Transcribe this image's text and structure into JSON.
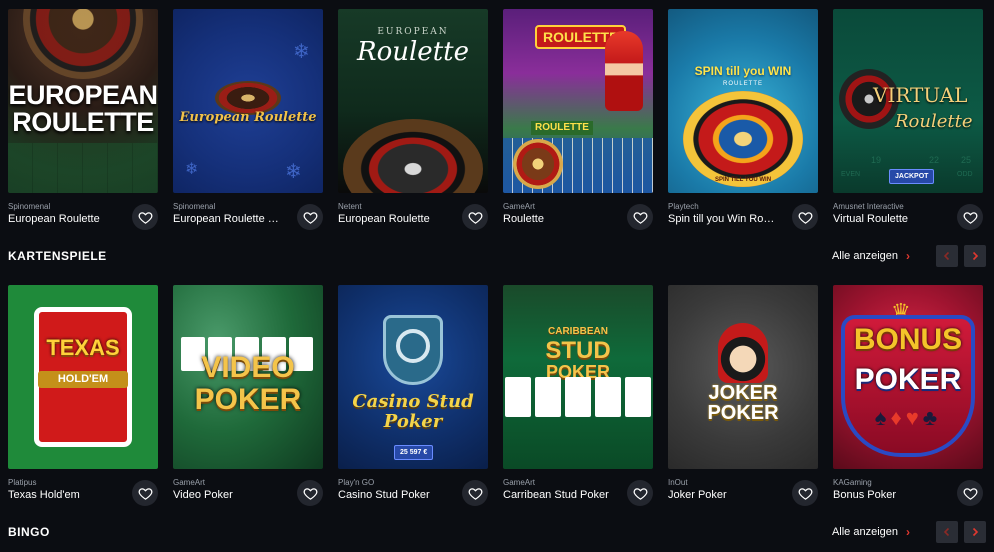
{
  "roulette_games": [
    {
      "provider": "Spinomenal",
      "name": "European Roulette",
      "art": "EUROPEAN\nROULETTE"
    },
    {
      "provider": "Spinomenal",
      "name": "European Roulette Ch...",
      "art": "European Roulette"
    },
    {
      "provider": "Netent",
      "name": "European Roulette",
      "art_small": "EUROPEAN",
      "art": "Roulette"
    },
    {
      "provider": "GameArt",
      "name": "Roulette",
      "art": "ROULETTE",
      "art2": "ROULETTE"
    },
    {
      "provider": "Playtech",
      "name": "Spin till you Win Roule...",
      "art": "SPIN till you WIN",
      "art_small": "ROULETTE",
      "art_wheel": "SPIN TILL YOU WIN"
    },
    {
      "provider": "Amusnet Interactive",
      "name": "Virtual Roulette",
      "art": "VIRTUAL",
      "art2": "Roulette",
      "badge": "JACKPOT",
      "felt_numbers": [
        "19",
        "22",
        "25"
      ],
      "felt_labels": [
        "EVEN",
        "ODD"
      ]
    }
  ],
  "sections": {
    "cards": {
      "title": "KARTENSPIELE",
      "show_all": "Alle anzeigen"
    },
    "bingo": {
      "title": "BINGO",
      "show_all": "Alle anzeigen"
    }
  },
  "card_games": [
    {
      "provider": "Platipus",
      "name": "Texas Hold'em",
      "art": "TEXAS",
      "art2": "HOLD'EM"
    },
    {
      "provider": "GameArt",
      "name": "Video Poker",
      "art": "VIDEO",
      "art2": "POKER"
    },
    {
      "provider": "Play'n GO",
      "name": "Casino Stud Poker",
      "art": "Casino Stud",
      "art2": "Poker",
      "badge": "25 597 €"
    },
    {
      "provider": "GameArt",
      "name": "Carribean Stud Poker",
      "art": "CARIBBEAN",
      "art2": "STUD",
      "art3": "POKER"
    },
    {
      "provider": "InOut",
      "name": "Joker Poker",
      "art": "JOKER",
      "art2": "POKER"
    },
    {
      "provider": "KAGaming",
      "name": "Bonus Poker",
      "art": "BONUS",
      "art2": "POKER"
    }
  ],
  "colors": {
    "accent": "#e0382f",
    "background": "#0b0d12",
    "fav_bg": "#23262e"
  },
  "icons": {
    "favorite": "heart-outline-icon",
    "prev": "chevron-left-icon",
    "next": "chevron-right-icon",
    "show_all": "chevron-right-icon"
  }
}
